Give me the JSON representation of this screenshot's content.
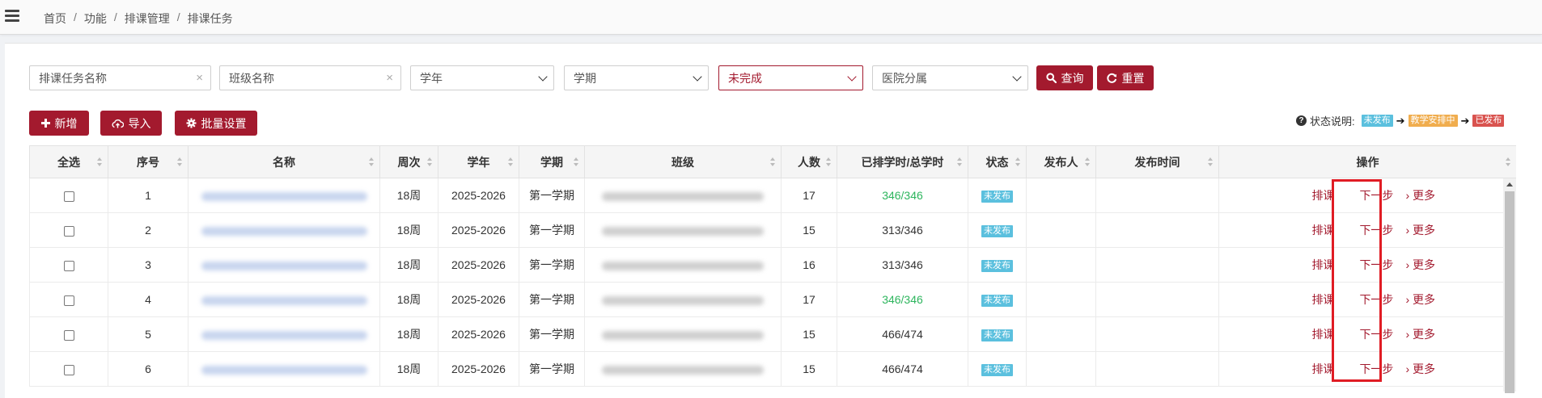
{
  "breadcrumb": [
    "首页",
    "功能",
    "排课管理",
    "排课任务"
  ],
  "filters": {
    "task_name_placeholder": "排课任务名称",
    "class_name_placeholder": "班级名称",
    "year": "学年",
    "term": "学期",
    "status": "未完成",
    "hospital": "医院分属",
    "clear_glyph": "×"
  },
  "buttons": {
    "query": "查询",
    "reset": "重置",
    "add": "新增",
    "import": "导入",
    "batch": "批量设置"
  },
  "legend": {
    "label": "状态说明:",
    "states": [
      "未发布",
      "教学安排中",
      "已发布"
    ],
    "arrow": "➔"
  },
  "colors": {
    "primary": "#a31a2e",
    "green": "#2db55d",
    "badge_blue": "#5bc0de",
    "badge_orange": "#f0ad4e",
    "badge_red": "#d9534f",
    "highlight": "#e01c24"
  },
  "table": {
    "headers": [
      "全选",
      "序号",
      "名称",
      "周次",
      "学年",
      "学期",
      "班级",
      "人数",
      "已排学时/总学时",
      "状态",
      "发布人",
      "发布时间",
      "操作"
    ],
    "actions": [
      "排课",
      "下一步",
      "› 更多"
    ],
    "rows": [
      {
        "no": "1",
        "weeks": "18周",
        "year": "2025-2026",
        "term": "第一学期",
        "count": "17",
        "hours": "346/346",
        "complete": true,
        "status": "未发布",
        "publisher": "",
        "time": ""
      },
      {
        "no": "2",
        "weeks": "18周",
        "year": "2025-2026",
        "term": "第一学期",
        "count": "15",
        "hours": "313/346",
        "complete": false,
        "status": "未发布",
        "publisher": "",
        "time": ""
      },
      {
        "no": "3",
        "weeks": "18周",
        "year": "2025-2026",
        "term": "第一学期",
        "count": "16",
        "hours": "313/346",
        "complete": false,
        "status": "未发布",
        "publisher": "",
        "time": ""
      },
      {
        "no": "4",
        "weeks": "18周",
        "year": "2025-2026",
        "term": "第一学期",
        "count": "17",
        "hours": "346/346",
        "complete": true,
        "status": "未发布",
        "publisher": "",
        "time": ""
      },
      {
        "no": "5",
        "weeks": "18周",
        "year": "2025-2026",
        "term": "第一学期",
        "count": "15",
        "hours": "466/474",
        "complete": false,
        "status": "未发布",
        "publisher": "",
        "time": ""
      },
      {
        "no": "6",
        "weeks": "18周",
        "year": "2025-2026",
        "term": "第一学期",
        "count": "15",
        "hours": "466/474",
        "complete": false,
        "status": "未发布",
        "publisher": "",
        "time": ""
      }
    ]
  }
}
